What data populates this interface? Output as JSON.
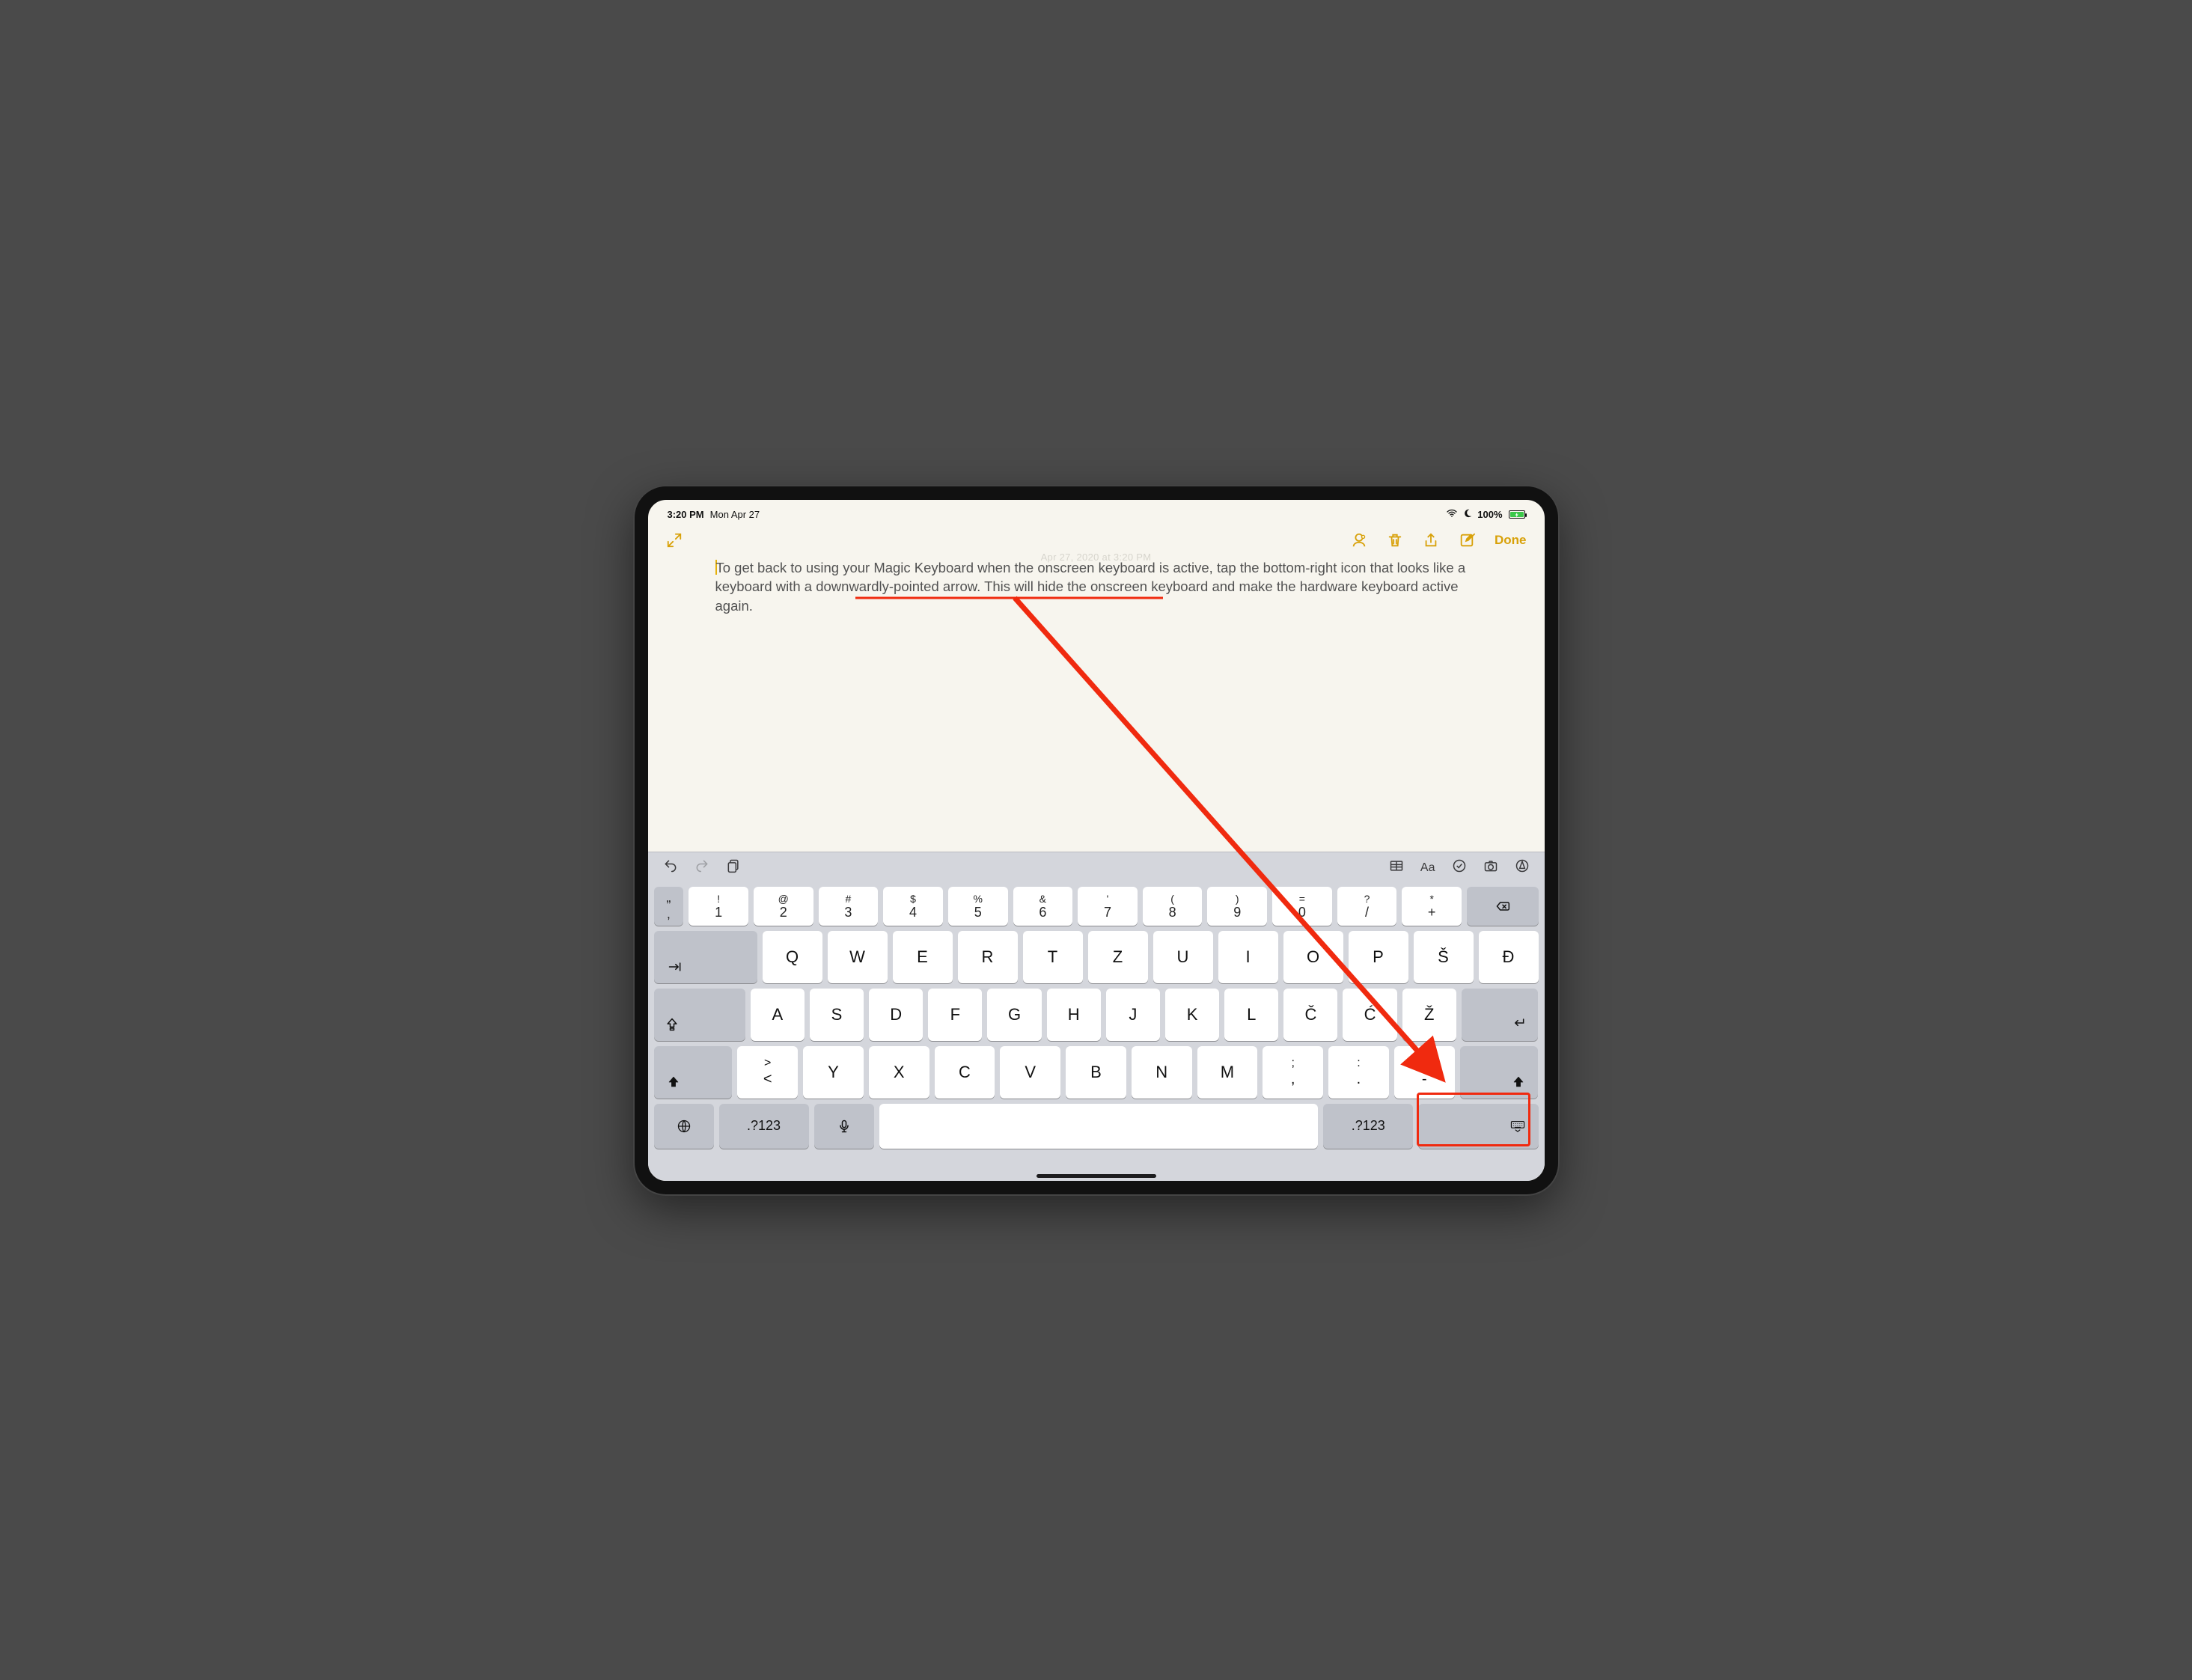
{
  "status": {
    "time": "3:20 PM",
    "date": "Mon Apr 27",
    "battery_pct": "100%"
  },
  "toolbar": {
    "done_label": "Done"
  },
  "note": {
    "watermark": "Apr 27, 2020 at 3:20 PM",
    "text_full": "To get back to using your Magic Keyboard when the onscreen keyboard is active, tap the bottom-right icon that looks like a keyboard with a downwardly-pointed arrow. This will hide the onscreen keyboard and make the hardware keyboard active again.",
    "seg1": "To get back to using your Magic Keyboard when the onscreen keyboard is active, tap the bottom-right icon that ",
    "seg2_underlined": "looks like a keyboard with a downwardly-pointed arrow.",
    "seg3": " This will hide the onscreen keyboard and make the hardware keyboard active again."
  },
  "keyboard": {
    "row0_quotes": {
      "top": "„",
      "bottom": "‚"
    },
    "row0": [
      {
        "sym": "!",
        "num": "1"
      },
      {
        "sym": "@",
        "num": "2"
      },
      {
        "sym": "#",
        "num": "3"
      },
      {
        "sym": "$",
        "num": "4"
      },
      {
        "sym": "%",
        "num": "5"
      },
      {
        "sym": "&",
        "num": "6"
      },
      {
        "sym": "'",
        "num": "7"
      },
      {
        "sym": "(",
        "num": "8"
      },
      {
        "sym": ")",
        "num": "9"
      },
      {
        "sym": "=",
        "num": "0"
      },
      {
        "sym": "?",
        "num": "/"
      },
      {
        "sym": "*",
        "num": "+"
      }
    ],
    "row1": [
      "Q",
      "W",
      "E",
      "R",
      "T",
      "Z",
      "U",
      "I",
      "O",
      "P",
      "Š",
      "Đ"
    ],
    "row2": [
      "A",
      "S",
      "D",
      "F",
      "G",
      "H",
      "J",
      "K",
      "L",
      "Č",
      "Ć",
      "Ž"
    ],
    "row3_lead": {
      "top": ">",
      "bottom": "<"
    },
    "row3": [
      "Y",
      "X",
      "C",
      "V",
      "B",
      "N",
      "M"
    ],
    "row3_p1": {
      "top": ";",
      "bottom": ","
    },
    "row3_p2": {
      "top": ":",
      "bottom": "."
    },
    "row3_p3": {
      "top": "_",
      "bottom": "-"
    },
    "numlock_label": ".?123"
  }
}
